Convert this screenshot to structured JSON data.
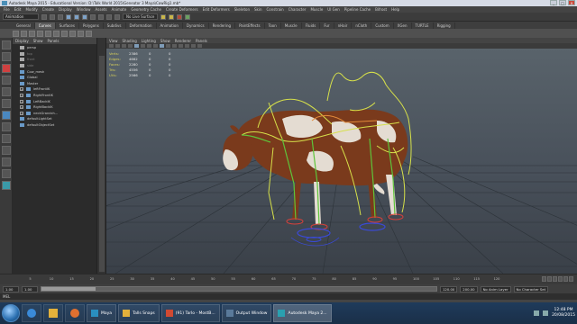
{
  "window": {
    "title": "Autodesk Maya 2015 - Educational Version: D:\\Talk World 2015\\Geneator 3 Maya\\CowRig1.mb*"
  },
  "menubar": [
    "File",
    "Edit",
    "Modify",
    "Create",
    "Display",
    "Window",
    "Assets",
    "Animate",
    "Geometry Cache",
    "Create Deformers",
    "Edit Deformers",
    "Skeleton",
    "Skin",
    "Constrain",
    "Character",
    "Muscle",
    "UI Gen",
    "Pipeline Cache",
    "Bifrost",
    "Help"
  ],
  "statusline": {
    "mode": "Animation",
    "live_surface": "No Live Surface"
  },
  "shelf_tabs": [
    {
      "label": "General",
      "active": false
    },
    {
      "label": "Curves",
      "active": true
    },
    {
      "label": "Surfaces",
      "active": false
    },
    {
      "label": "Polygons",
      "active": false
    },
    {
      "label": "Subdivs",
      "active": false
    },
    {
      "label": "Deformation",
      "active": false
    },
    {
      "label": "Animation",
      "active": false
    },
    {
      "label": "Dynamics",
      "active": false
    },
    {
      "label": "Rendering",
      "active": false
    },
    {
      "label": "PaintEffects",
      "active": false
    },
    {
      "label": "Toon",
      "active": false
    },
    {
      "label": "Muscle",
      "active": false
    },
    {
      "label": "Fluids",
      "active": false
    },
    {
      "label": "Fur",
      "active": false
    },
    {
      "label": "nHair",
      "active": false
    },
    {
      "label": "nCloth",
      "active": false
    },
    {
      "label": "Custom",
      "active": false
    },
    {
      "label": "XGen",
      "active": false
    },
    {
      "label": "TURTLE",
      "active": false
    },
    {
      "label": "Rigging",
      "active": false
    }
  ],
  "outliner": {
    "menu": [
      "Display",
      "Show",
      "Panels"
    ],
    "items": [
      {
        "label": "persp",
        "dim": false
      },
      {
        "label": "top",
        "dim": true
      },
      {
        "label": "front",
        "dim": true
      },
      {
        "label": "side",
        "dim": true
      },
      {
        "label": "Cow_mesh",
        "dim": false
      },
      {
        "label": "Global",
        "dim": false
      },
      {
        "label": "Master",
        "dim": false
      },
      {
        "label": "leftFrontIK",
        "dim": false
      },
      {
        "label": "RightFrontIK",
        "dim": false
      },
      {
        "label": "LeftBackIK",
        "dim": false
      },
      {
        "label": "RightBackIK",
        "dim": false
      },
      {
        "label": "neckGrandch...",
        "dim": false
      },
      {
        "label": "defaultLightSet",
        "dim": false
      },
      {
        "label": "defaultObjectSet",
        "dim": false
      }
    ]
  },
  "viewport": {
    "menu": [
      "View",
      "Shading",
      "Lighting",
      "Show",
      "Renderer",
      "Panels"
    ],
    "hud": [
      {
        "label": "Verts:",
        "a": "2386",
        "b": "0",
        "c": "0"
      },
      {
        "label": "Edges:",
        "a": "4662",
        "b": "0",
        "c": "0"
      },
      {
        "label": "Faces:",
        "a": "2280",
        "b": "0",
        "c": "0"
      },
      {
        "label": "Tris:",
        "a": "4556",
        "b": "0",
        "c": "0"
      },
      {
        "label": "UVs:",
        "a": "2566",
        "b": "0",
        "c": "0"
      }
    ]
  },
  "timeline": {
    "ticks": [
      "5",
      "10",
      "15",
      "20",
      "25",
      "30",
      "35",
      "40",
      "45",
      "50",
      "55",
      "60",
      "65",
      "70",
      "75",
      "80",
      "85",
      "90",
      "95",
      "100",
      "105",
      "110",
      "115",
      "120"
    ],
    "current_frame": "1.00"
  },
  "range": {
    "start": "1.00",
    "inner_start": "1.00",
    "inner_end_label": "120",
    "end": "120.00",
    "max": "200.00",
    "anim_layer": "No Anim Layer",
    "character_set": "No Character Set"
  },
  "cmdline": {
    "label": "MEL"
  },
  "taskbar": {
    "items": [
      {
        "label": "Maya",
        "color": "#2a8fc0",
        "active": false
      },
      {
        "label": "Talls Snaps",
        "color": "#e3b13b",
        "active": false
      },
      {
        "label": "(91) Tarlo - MostB...",
        "color": "#d14a32",
        "active": false
      },
      {
        "label": "Output Window",
        "color": "#5a7a9a",
        "active": false
      },
      {
        "label": "Autodesk Maya 2...",
        "color": "#2aa0b0",
        "active": true
      }
    ],
    "time": "12:48 PM",
    "date": "20/08/2015"
  },
  "colors": {
    "cow_brown": "#7a3a1c",
    "cow_white": "#e4dcd2",
    "control_yellow": "#d6e04a",
    "control_green": "#5ec43a",
    "control_red": "#d8403a",
    "control_blue": "#3a4ad8"
  }
}
